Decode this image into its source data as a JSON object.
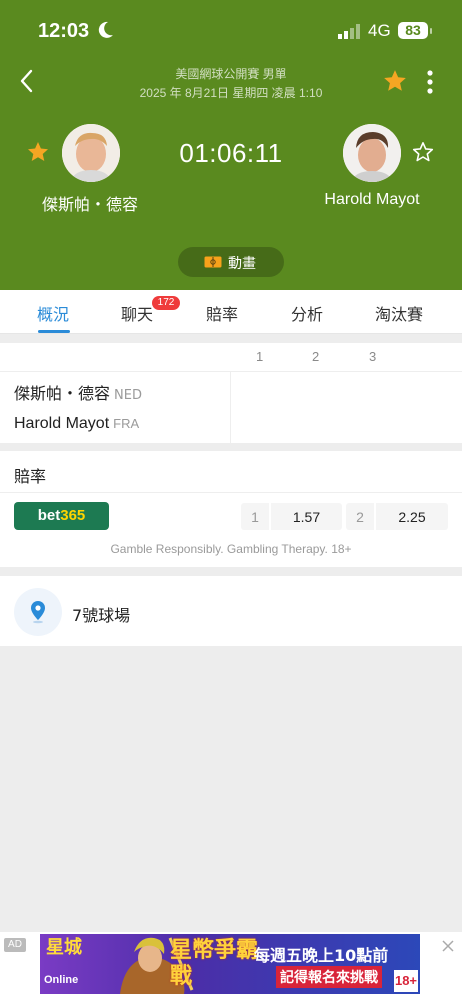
{
  "status": {
    "time": "12:03",
    "network": "4G",
    "battery": "83"
  },
  "header": {
    "league": "美國網球公開賽 男單",
    "datetime": "2025 年 8月21日 星期四 凌晨 1:10",
    "elapsed": "01:06:11"
  },
  "players": {
    "home": {
      "name": "傑斯帕・德容",
      "country": "NED",
      "favorited": true
    },
    "away": {
      "name": "Harold Mayot",
      "country": "FRA",
      "favorited": false
    }
  },
  "animation_button": "動畫",
  "tabs": [
    {
      "label": "概況",
      "active": true
    },
    {
      "label": "聊天",
      "badge": "172"
    },
    {
      "label": "賠率"
    },
    {
      "label": "分析"
    },
    {
      "label": "淘汰賽"
    }
  ],
  "score": {
    "set_headers": [
      "1",
      "2",
      "3"
    ]
  },
  "odds": {
    "title": "賠率",
    "bookmaker_main": "bet",
    "bookmaker_accent": "365",
    "option1_label": "1",
    "option1_value": "1.57",
    "option2_label": "2",
    "option2_value": "2.25",
    "disclaimer": "Gamble Responsibly. Gambling Therapy. 18+"
  },
  "venue": {
    "name": "7號球場"
  },
  "ad": {
    "tag": "AD",
    "logo": "星城",
    "logo_sub": "Online",
    "game": "星幣爭霸戰",
    "line1": "每週五晚上10點前",
    "line2": "記得報名來挑戰",
    "age": "18+"
  },
  "colors": {
    "header_green": "#5a8a1f",
    "accent_blue": "#2a8bd8",
    "star_gold": "#f5a623",
    "badge_red": "#ef3b3b"
  }
}
